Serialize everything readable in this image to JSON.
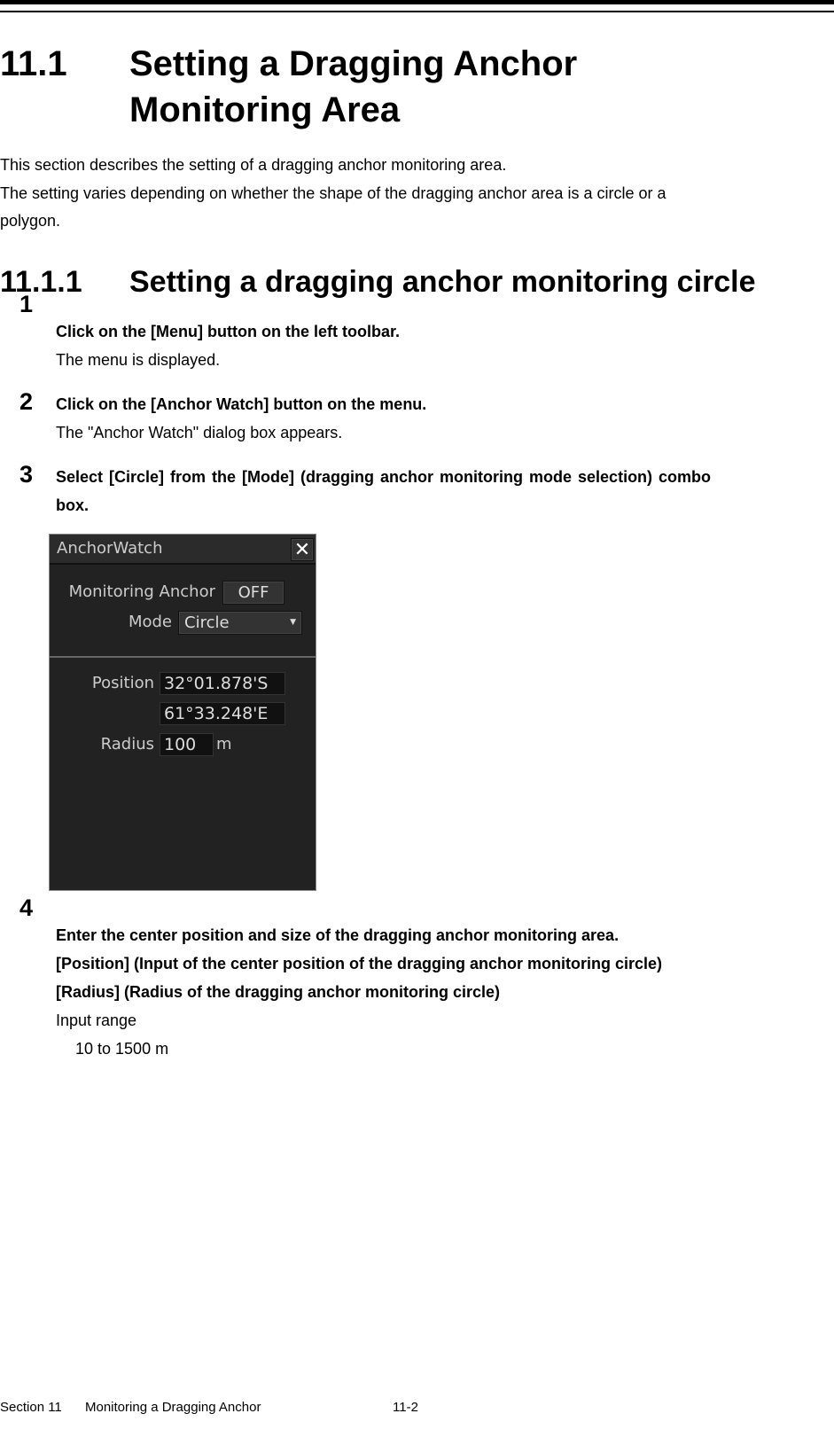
{
  "heading": {
    "number": "11.1",
    "title_line1": "Setting a Dragging Anchor",
    "title_line2": "Monitoring Area"
  },
  "intro": [
    "This section describes the setting of a dragging anchor monitoring area.",
    "The setting varies depending on whether the shape of the dragging anchor area is a circle or a",
    "polygon."
  ],
  "subheading": {
    "number": "11.1.1",
    "title": "Setting a dragging anchor monitoring circle"
  },
  "steps": [
    {
      "num": "1",
      "instruction": "Click on the [Menu] button on the left toolbar.",
      "result": "The menu is displayed."
    },
    {
      "num": "2",
      "instruction": "Click on the [Anchor Watch] button on the menu.",
      "result": "The \"Anchor Watch\" dialog box appears."
    },
    {
      "num": "3",
      "instruction_line1": "Select [Circle] from the [Mode] (dragging anchor monitoring mode selection) combo",
      "instruction_line2": "box."
    },
    {
      "num": "4",
      "instruction": "Enter the center position and size of the dragging anchor monitoring area.",
      "line2": "[Position] (Input of the center position of the dragging anchor monitoring circle)",
      "line3": "[Radius] (Radius of the dragging anchor monitoring circle)",
      "line4": "Input range",
      "line5": "10 to 1500 m"
    }
  ],
  "dialog": {
    "title": "AnchorWatch",
    "close_icon": "close-x",
    "monitoring_label": "Monitoring Anchor",
    "monitoring_value": "OFF",
    "mode_label": "Mode",
    "mode_value": "Circle",
    "position_label": "Position",
    "lat": "32°01.878'S",
    "lon": "61°33.248'E",
    "radius_label": "Radius",
    "radius_value": "100",
    "radius_unit": "m"
  },
  "footer": {
    "section": "Section 11",
    "chapter": "Monitoring a Dragging Anchor",
    "page": "11-2"
  }
}
